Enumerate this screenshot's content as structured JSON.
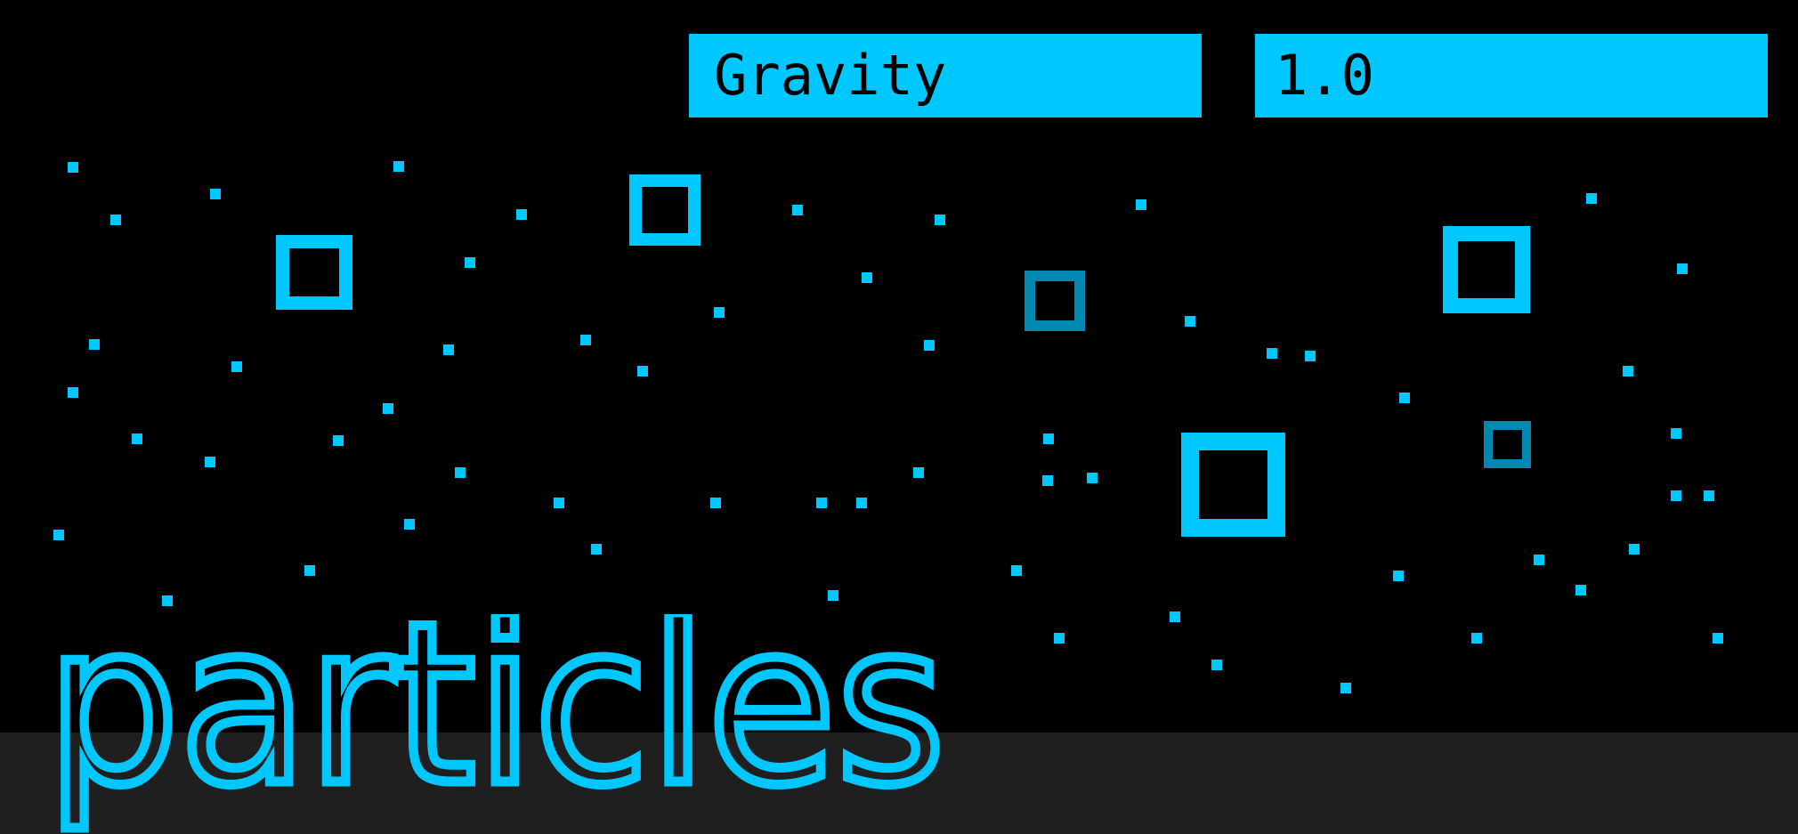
{
  "parameter": {
    "name": "Gravity",
    "value": "1.0"
  },
  "logo": {
    "text": "particles"
  },
  "colors": {
    "background": "#000000",
    "floor": "#1f1f1f",
    "accent": "#00c8ff",
    "accent_dim": "#0088b0",
    "field_text": "#000000"
  }
}
